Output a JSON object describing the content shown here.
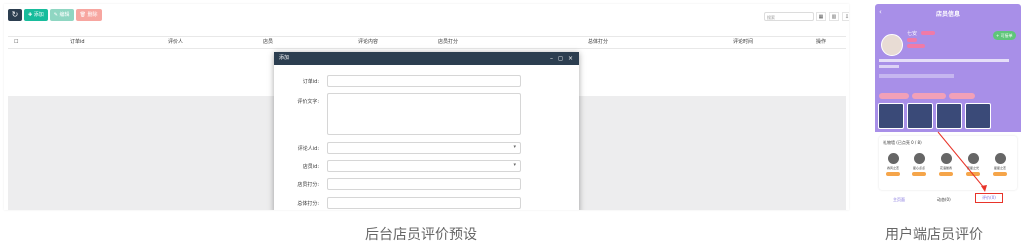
{
  "toolbar": {
    "refresh_label": "↻",
    "add_label": "✚ 添加",
    "edit_label": "✎ 编辑",
    "delete_label": "🗑 删除"
  },
  "search": {
    "placeholder": "搜索"
  },
  "table": {
    "columns": [
      "订单id",
      "评价人",
      "店员",
      "评论内容",
      "店员打分",
      "总体打分",
      "评论时间",
      "操作"
    ]
  },
  "modal": {
    "title": "添加",
    "fields": [
      {
        "label": "订单id:",
        "value": ""
      },
      {
        "label": "评价文字:",
        "value": ""
      },
      {
        "label": "评论人id:",
        "value": ""
      },
      {
        "label": "店员id:",
        "value": ""
      },
      {
        "label": "店员打分:",
        "value": ""
      },
      {
        "label": "总体打分:",
        "value": ""
      }
    ]
  },
  "captions": {
    "admin": "后台店员评价预设",
    "user": "用户端店员评价"
  },
  "phone": {
    "title": "店员信息",
    "profile_name": "七安",
    "follow_label": "+ 可接单",
    "gift_section_label": "礼物墙 (已点亮 0 / 8)",
    "gifts": [
      "春风之恋",
      "星心点点",
      "花语馨香",
      "星星之光",
      "星星之恋"
    ],
    "tabs": [
      "主页面",
      "动态(0)",
      "评价(0)"
    ]
  },
  "colors": {
    "admin_header": "#2c3e50",
    "add_green": "#18bc9c",
    "phone_purple": "#a88fe8",
    "highlight_red": "#e8342a"
  }
}
